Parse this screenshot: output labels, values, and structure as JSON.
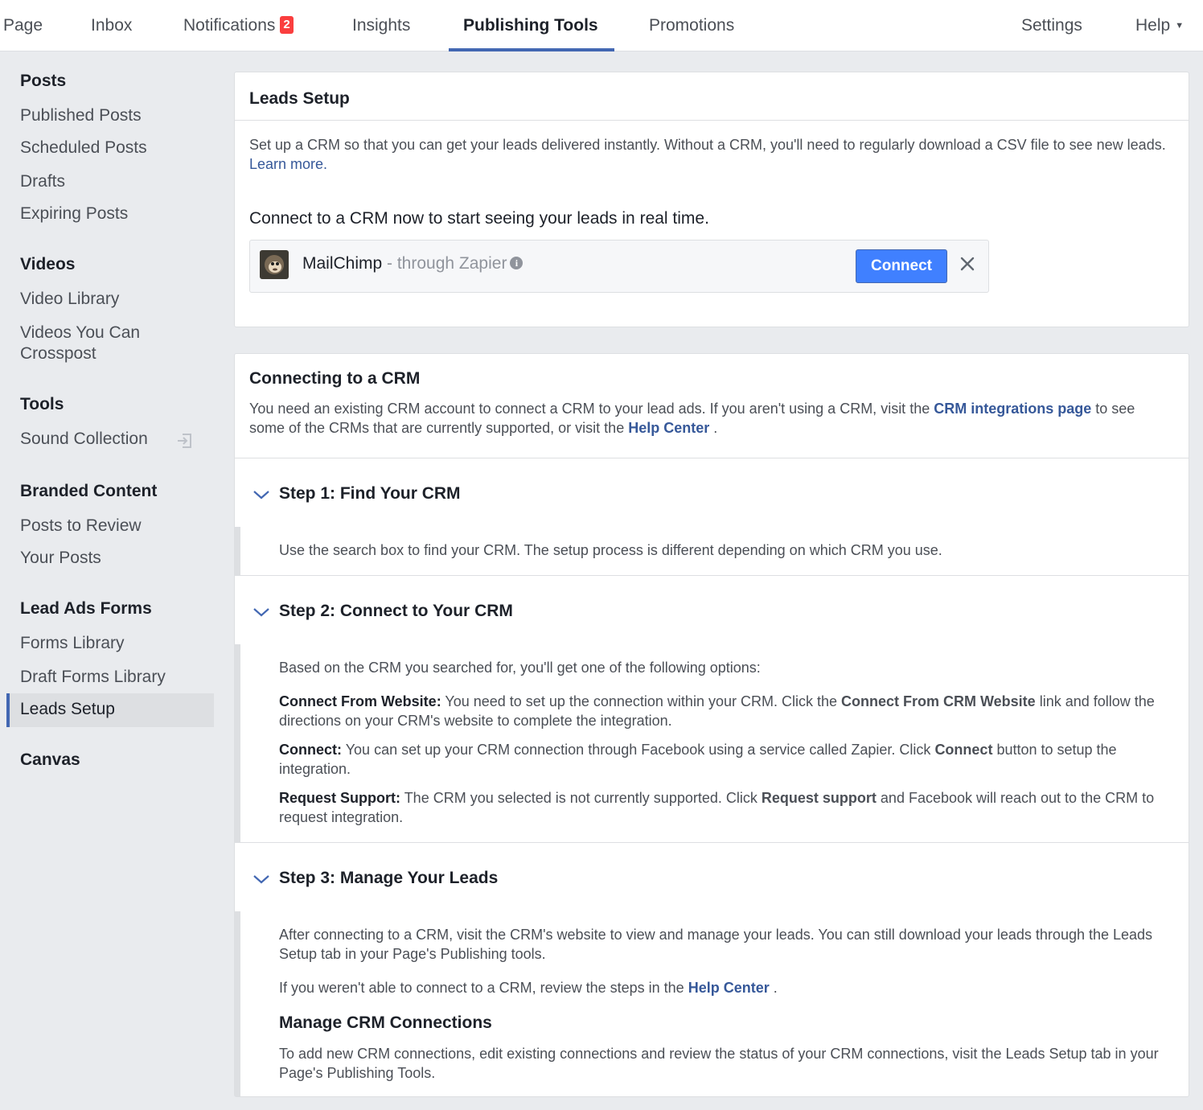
{
  "topnav": {
    "tabs": [
      {
        "label": "Page"
      },
      {
        "label": "Inbox"
      },
      {
        "label": "Notifications",
        "badge": "2"
      },
      {
        "label": "Insights"
      },
      {
        "label": "Publishing Tools"
      },
      {
        "label": "Promotions"
      }
    ],
    "settings_label": "Settings",
    "help_label": "Help",
    "active_tab": "Publishing Tools",
    "accent_color": "#4267b2",
    "badge_color": "#fa3e3e"
  },
  "sidebar": {
    "posts_heading": "Posts",
    "posts_items": [
      "Published Posts",
      "Scheduled Posts",
      "Drafts",
      "Expiring Posts"
    ],
    "videos_heading": "Videos",
    "videos_items": [
      "Video Library",
      "Videos You Can",
      "Crosspost"
    ],
    "tools_heading": "Tools",
    "tools_items": [
      "Sound Collection"
    ],
    "branded_heading": "Branded Content",
    "branded_items": [
      "Posts to Review",
      "Your Posts"
    ],
    "leadads_heading": "Lead Ads Forms",
    "leadads_items": [
      "Forms Library",
      "Draft Forms Library",
      "Leads Setup"
    ],
    "canvas_heading": "Canvas",
    "active_item": "Leads Setup",
    "external_icon": "external-link-icon"
  },
  "leads_setup": {
    "title": "Leads Setup",
    "intro_a": "Set up a CRM so that you can get your leads delivered instantly. Without a CRM, you'll need to regularly download a CSV file to see new leads.",
    "learn_more": "Learn more.",
    "connect_prompt": "Connect to a CRM now to start seeing your leads in real time.",
    "crm_name": "MailChimp",
    "crm_via": " - through Zapier",
    "info_icon": "info-icon",
    "connect_button": "Connect",
    "close_icon": "close-icon",
    "button_color": "#4080ff"
  },
  "connecting": {
    "title": "Connecting to a CRM",
    "intro_a": "You need an existing CRM account to connect a CRM to your lead ads. If you aren't using a CRM, visit the",
    "intro_link1": "CRM integrations page",
    "intro_b": "to see some of the CRMs that are currently supported, or visit the",
    "intro_link2": "Help Center",
    "intro_c": ".",
    "step1": {
      "title": "Step 1: Find Your CRM",
      "body": "Use the search box to find your CRM. The setup process is different depending on which CRM you use."
    },
    "step2": {
      "title": "Step 2: Connect to Your CRM",
      "lead": "Based on the CRM you searched for, you'll get one of the following options:",
      "opt1_label": "Connect From Website:",
      "opt1_a": "You need to set up the connection within your CRM. Click the",
      "opt1_bold": "Connect From CRM Website",
      "opt1_b": "link and follow the directions on your CRM's website to complete the integration.",
      "opt2_label": "Connect:",
      "opt2_a": "You can set up your CRM connection through Facebook using a service called Zapier. Click",
      "opt2_bold": "Connect",
      "opt2_b": "button to setup the integration.",
      "opt3_label": "Request Support:",
      "opt3_a": "The CRM you selected is not currently supported. Click",
      "opt3_bold": "Request support",
      "opt3_b": "and Facebook will reach out to the CRM to request integration."
    },
    "step3": {
      "title": "Step 3: Manage Your Leads",
      "body": "After connecting to a CRM, visit the CRM's website to view and manage your leads. You can still download your leads through the Leads Setup tab in your Page's Publishing tools.",
      "help_a": "If you weren't able to connect to a CRM, review the steps in the",
      "help_link": "Help Center",
      "help_b": ".",
      "manage_title": "Manage CRM Connections",
      "manage_body": "To add new CRM connections, edit existing connections and review the status of your CRM connections, visit the Leads Setup tab in your Page's Publishing Tools."
    },
    "chevron_icon": "chevron-down-icon"
  }
}
